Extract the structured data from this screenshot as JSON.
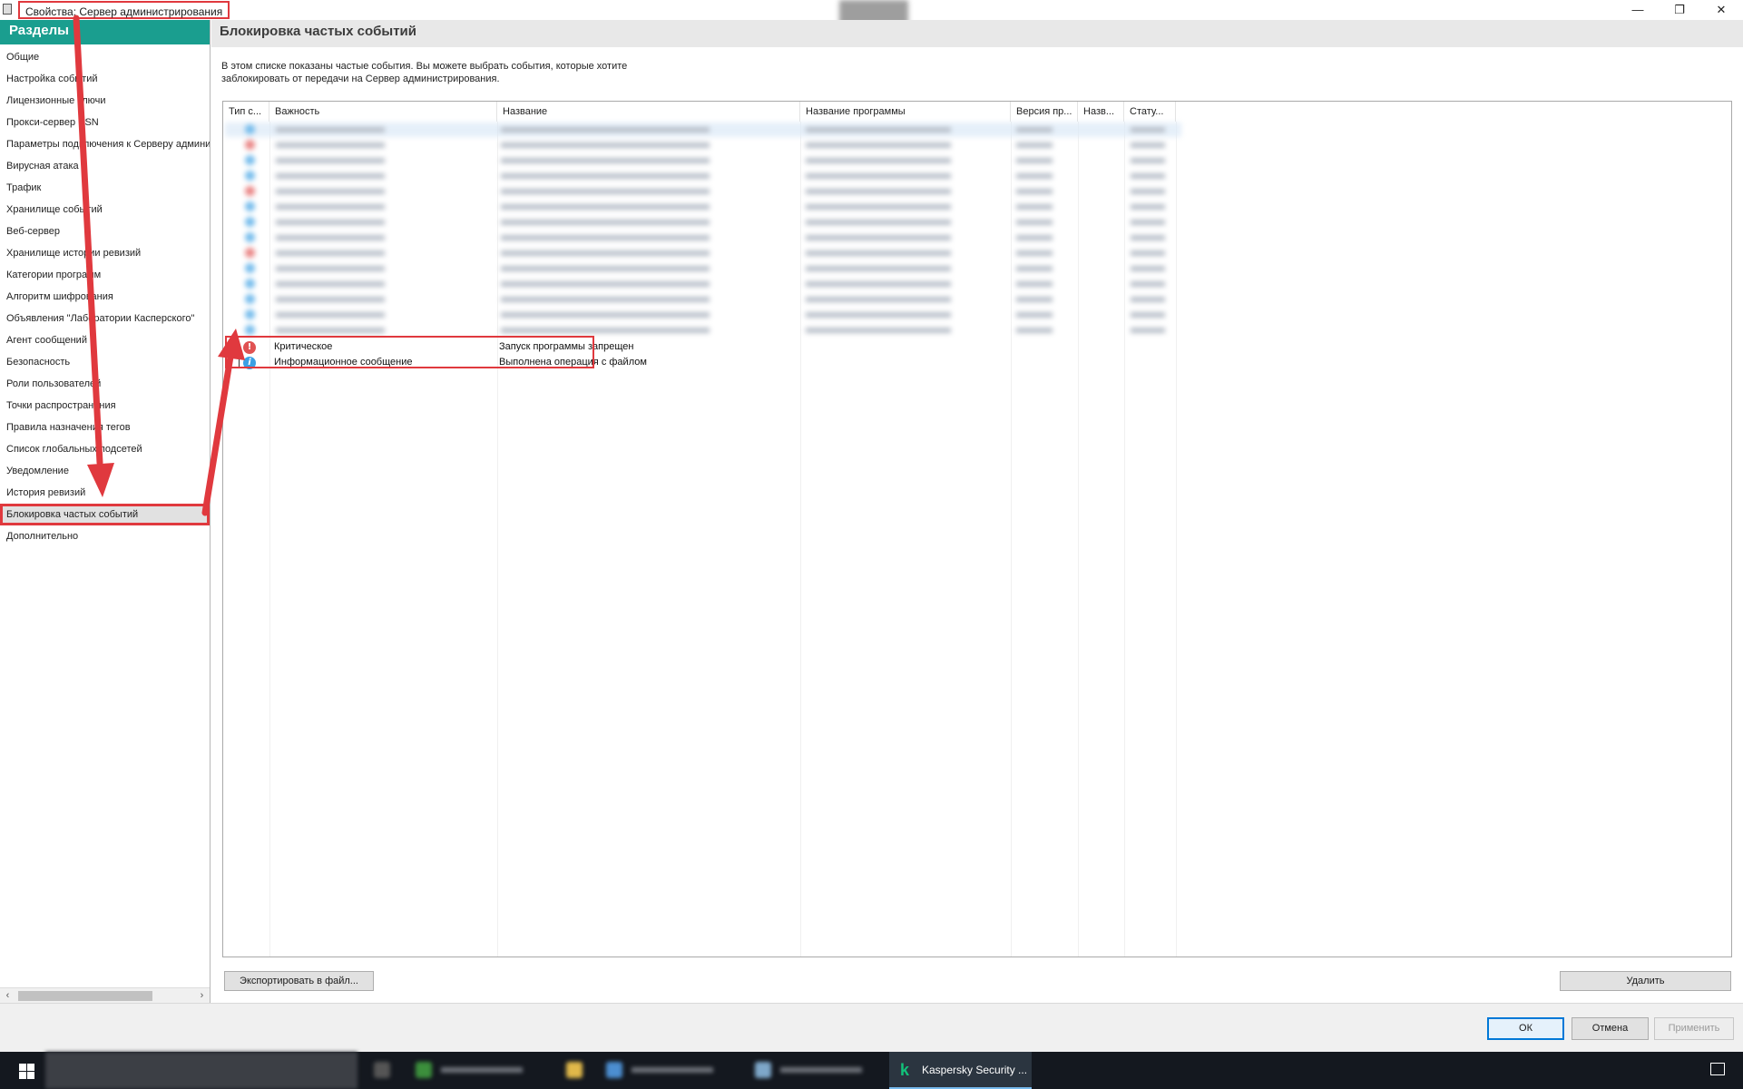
{
  "window": {
    "title": "Свойства: Сервер администрирования",
    "minimize_glyph": "—",
    "restore_glyph": "❐",
    "close_glyph": "✕"
  },
  "sidebar": {
    "header": "Разделы",
    "items": [
      {
        "label": "Общие"
      },
      {
        "label": "Настройка событий"
      },
      {
        "label": "Лицензионные ключи"
      },
      {
        "label": "Прокси-сервер KSN"
      },
      {
        "label": "Параметры подключения к Серверу админи"
      },
      {
        "label": "Вирусная атака"
      },
      {
        "label": "Трафик"
      },
      {
        "label": "Хранилище событий"
      },
      {
        "label": "Веб-сервер"
      },
      {
        "label": "Хранилище истории ревизий"
      },
      {
        "label": "Категории программ"
      },
      {
        "label": "Алгоритм шифрования"
      },
      {
        "label": "Объявления \"Лаборатории Касперского\""
      },
      {
        "label": "Агент сообщений"
      },
      {
        "label": "Безопасность"
      },
      {
        "label": "Роли пользователей"
      },
      {
        "label": "Точки распространения"
      },
      {
        "label": "Правила назначения тегов"
      },
      {
        "label": "Список глобальных подсетей"
      },
      {
        "label": "Уведомление"
      },
      {
        "label": "История ревизий"
      },
      {
        "label": "Блокировка частых событий",
        "selected": true
      },
      {
        "label": "Дополнительно"
      }
    ],
    "scroll_left": "‹",
    "scroll_right": "›"
  },
  "content": {
    "title": "Блокировка частых событий",
    "description": "В этом списке показаны частые события. Вы можете выбрать события, которые хотите заблокировать от передачи на Сервер администрирования."
  },
  "table": {
    "columns": [
      "Тип с...",
      "Важность",
      "Название",
      "Название программы",
      "Версия пр...",
      "Назв...",
      "Стату..."
    ],
    "rows": [
      {
        "severity": "Критическое",
        "name": "Запуск программы запрещен",
        "icon": "critical-icon",
        "icon_glyph": "!",
        "checked": false
      },
      {
        "severity": "Информационное сообщение",
        "name": "Выполнена операция с файлом",
        "icon": "info-icon",
        "icon_glyph": "i",
        "checked": false
      }
    ]
  },
  "buttons": {
    "export": "Экспортировать в файл...",
    "delete": "Удалить",
    "ok": "ОК",
    "cancel": "Отмена",
    "apply": "Применить"
  },
  "taskbar": {
    "active_app": "Kaspersky Security ...",
    "active_logo": "k"
  },
  "colors": {
    "accent": "#1a9e8f",
    "annotation": "#e0393e",
    "critical": "#e05252",
    "info": "#3ba0e4"
  }
}
